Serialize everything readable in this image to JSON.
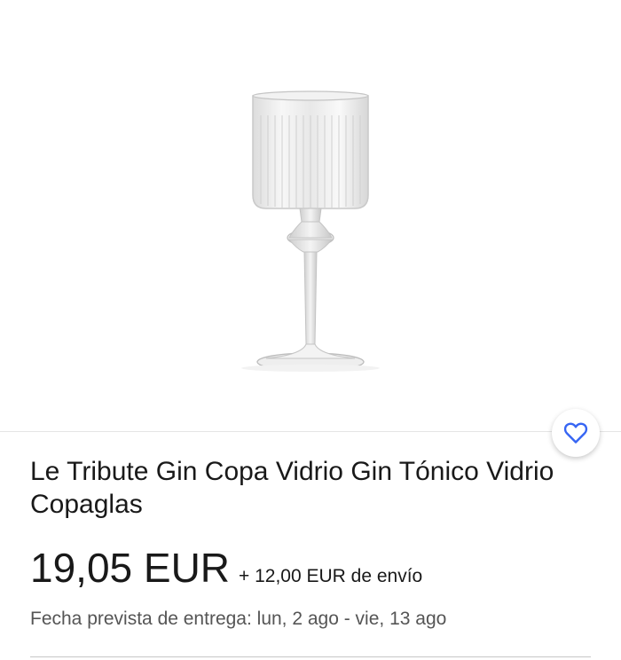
{
  "listing": {
    "title": "Le Tribute Gin Copa Vidrio Gin Tónico Vidrio Copaglas",
    "price": "19,05 EUR",
    "shipping": "+ 12,00 EUR de envío",
    "delivery": "Fecha prevista de entrega: lun, 2 ago - vie, 13 ago"
  },
  "watch_icon": "heart-icon",
  "colors": {
    "accent": "#3665f3",
    "text": "#191919",
    "secondary_text": "#555555"
  }
}
